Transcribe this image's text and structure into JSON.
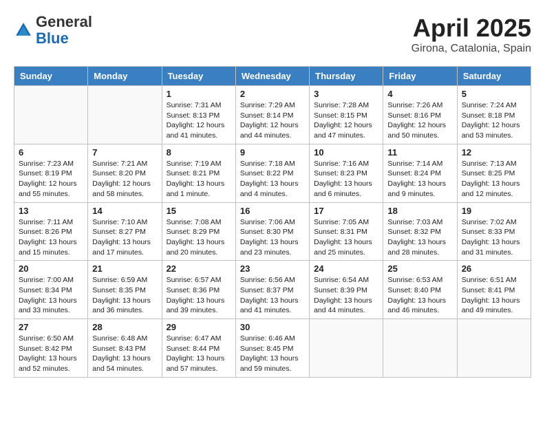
{
  "header": {
    "logo_general": "General",
    "logo_blue": "Blue",
    "title": "April 2025",
    "subtitle": "Girona, Catalonia, Spain"
  },
  "days_of_week": [
    "Sunday",
    "Monday",
    "Tuesday",
    "Wednesday",
    "Thursday",
    "Friday",
    "Saturday"
  ],
  "weeks": [
    [
      {
        "day": "",
        "sunrise": "",
        "sunset": "",
        "daylight": ""
      },
      {
        "day": "",
        "sunrise": "",
        "sunset": "",
        "daylight": ""
      },
      {
        "day": "1",
        "sunrise": "Sunrise: 7:31 AM",
        "sunset": "Sunset: 8:13 PM",
        "daylight": "Daylight: 12 hours and 41 minutes."
      },
      {
        "day": "2",
        "sunrise": "Sunrise: 7:29 AM",
        "sunset": "Sunset: 8:14 PM",
        "daylight": "Daylight: 12 hours and 44 minutes."
      },
      {
        "day": "3",
        "sunrise": "Sunrise: 7:28 AM",
        "sunset": "Sunset: 8:15 PM",
        "daylight": "Daylight: 12 hours and 47 minutes."
      },
      {
        "day": "4",
        "sunrise": "Sunrise: 7:26 AM",
        "sunset": "Sunset: 8:16 PM",
        "daylight": "Daylight: 12 hours and 50 minutes."
      },
      {
        "day": "5",
        "sunrise": "Sunrise: 7:24 AM",
        "sunset": "Sunset: 8:18 PM",
        "daylight": "Daylight: 12 hours and 53 minutes."
      }
    ],
    [
      {
        "day": "6",
        "sunrise": "Sunrise: 7:23 AM",
        "sunset": "Sunset: 8:19 PM",
        "daylight": "Daylight: 12 hours and 55 minutes."
      },
      {
        "day": "7",
        "sunrise": "Sunrise: 7:21 AM",
        "sunset": "Sunset: 8:20 PM",
        "daylight": "Daylight: 12 hours and 58 minutes."
      },
      {
        "day": "8",
        "sunrise": "Sunrise: 7:19 AM",
        "sunset": "Sunset: 8:21 PM",
        "daylight": "Daylight: 13 hours and 1 minute."
      },
      {
        "day": "9",
        "sunrise": "Sunrise: 7:18 AM",
        "sunset": "Sunset: 8:22 PM",
        "daylight": "Daylight: 13 hours and 4 minutes."
      },
      {
        "day": "10",
        "sunrise": "Sunrise: 7:16 AM",
        "sunset": "Sunset: 8:23 PM",
        "daylight": "Daylight: 13 hours and 6 minutes."
      },
      {
        "day": "11",
        "sunrise": "Sunrise: 7:14 AM",
        "sunset": "Sunset: 8:24 PM",
        "daylight": "Daylight: 13 hours and 9 minutes."
      },
      {
        "day": "12",
        "sunrise": "Sunrise: 7:13 AM",
        "sunset": "Sunset: 8:25 PM",
        "daylight": "Daylight: 13 hours and 12 minutes."
      }
    ],
    [
      {
        "day": "13",
        "sunrise": "Sunrise: 7:11 AM",
        "sunset": "Sunset: 8:26 PM",
        "daylight": "Daylight: 13 hours and 15 minutes."
      },
      {
        "day": "14",
        "sunrise": "Sunrise: 7:10 AM",
        "sunset": "Sunset: 8:27 PM",
        "daylight": "Daylight: 13 hours and 17 minutes."
      },
      {
        "day": "15",
        "sunrise": "Sunrise: 7:08 AM",
        "sunset": "Sunset: 8:29 PM",
        "daylight": "Daylight: 13 hours and 20 minutes."
      },
      {
        "day": "16",
        "sunrise": "Sunrise: 7:06 AM",
        "sunset": "Sunset: 8:30 PM",
        "daylight": "Daylight: 13 hours and 23 minutes."
      },
      {
        "day": "17",
        "sunrise": "Sunrise: 7:05 AM",
        "sunset": "Sunset: 8:31 PM",
        "daylight": "Daylight: 13 hours and 25 minutes."
      },
      {
        "day": "18",
        "sunrise": "Sunrise: 7:03 AM",
        "sunset": "Sunset: 8:32 PM",
        "daylight": "Daylight: 13 hours and 28 minutes."
      },
      {
        "day": "19",
        "sunrise": "Sunrise: 7:02 AM",
        "sunset": "Sunset: 8:33 PM",
        "daylight": "Daylight: 13 hours and 31 minutes."
      }
    ],
    [
      {
        "day": "20",
        "sunrise": "Sunrise: 7:00 AM",
        "sunset": "Sunset: 8:34 PM",
        "daylight": "Daylight: 13 hours and 33 minutes."
      },
      {
        "day": "21",
        "sunrise": "Sunrise: 6:59 AM",
        "sunset": "Sunset: 8:35 PM",
        "daylight": "Daylight: 13 hours and 36 minutes."
      },
      {
        "day": "22",
        "sunrise": "Sunrise: 6:57 AM",
        "sunset": "Sunset: 8:36 PM",
        "daylight": "Daylight: 13 hours and 39 minutes."
      },
      {
        "day": "23",
        "sunrise": "Sunrise: 6:56 AM",
        "sunset": "Sunset: 8:37 PM",
        "daylight": "Daylight: 13 hours and 41 minutes."
      },
      {
        "day": "24",
        "sunrise": "Sunrise: 6:54 AM",
        "sunset": "Sunset: 8:39 PM",
        "daylight": "Daylight: 13 hours and 44 minutes."
      },
      {
        "day": "25",
        "sunrise": "Sunrise: 6:53 AM",
        "sunset": "Sunset: 8:40 PM",
        "daylight": "Daylight: 13 hours and 46 minutes."
      },
      {
        "day": "26",
        "sunrise": "Sunrise: 6:51 AM",
        "sunset": "Sunset: 8:41 PM",
        "daylight": "Daylight: 13 hours and 49 minutes."
      }
    ],
    [
      {
        "day": "27",
        "sunrise": "Sunrise: 6:50 AM",
        "sunset": "Sunset: 8:42 PM",
        "daylight": "Daylight: 13 hours and 52 minutes."
      },
      {
        "day": "28",
        "sunrise": "Sunrise: 6:48 AM",
        "sunset": "Sunset: 8:43 PM",
        "daylight": "Daylight: 13 hours and 54 minutes."
      },
      {
        "day": "29",
        "sunrise": "Sunrise: 6:47 AM",
        "sunset": "Sunset: 8:44 PM",
        "daylight": "Daylight: 13 hours and 57 minutes."
      },
      {
        "day": "30",
        "sunrise": "Sunrise: 6:46 AM",
        "sunset": "Sunset: 8:45 PM",
        "daylight": "Daylight: 13 hours and 59 minutes."
      },
      {
        "day": "",
        "sunrise": "",
        "sunset": "",
        "daylight": ""
      },
      {
        "day": "",
        "sunrise": "",
        "sunset": "",
        "daylight": ""
      },
      {
        "day": "",
        "sunrise": "",
        "sunset": "",
        "daylight": ""
      }
    ]
  ]
}
